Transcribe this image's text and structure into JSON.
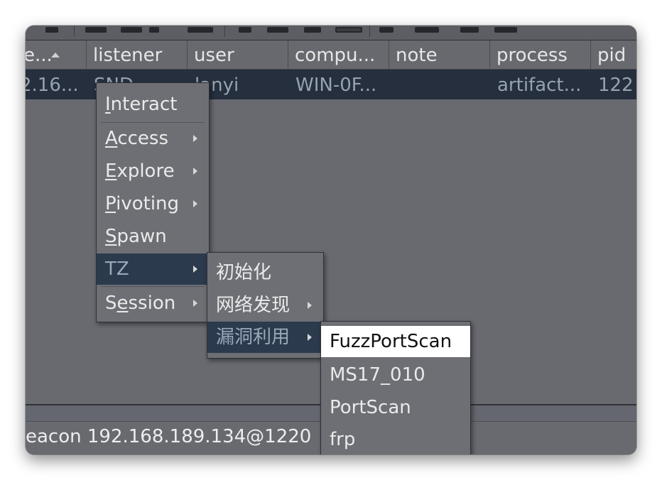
{
  "table": {
    "columns": [
      "e...",
      "listener",
      "user",
      "compu...",
      "note",
      "process",
      "pid"
    ],
    "row": {
      "external": "2.16...",
      "listener": "SND",
      "user": "lanyi",
      "computer": "WIN-0F...",
      "note": "",
      "process": "artifact...",
      "pid": "122"
    }
  },
  "status_bar": {
    "text": "eacon 192.168.189.134@1220"
  },
  "context_menu": {
    "items": [
      {
        "label_pre": "",
        "mnemonic": "I",
        "label_post": "nteract",
        "submenu": false
      },
      {
        "label_pre": "",
        "mnemonic": "A",
        "label_post": "ccess",
        "submenu": true
      },
      {
        "label_pre": "",
        "mnemonic": "E",
        "label_post": "xplore",
        "submenu": true
      },
      {
        "label_pre": "",
        "mnemonic": "P",
        "label_post": "ivoting",
        "submenu": true
      },
      {
        "label_pre": "",
        "mnemonic": "S",
        "label_post": "pawn",
        "submenu": false
      },
      {
        "label_pre": "TZ",
        "mnemonic": "",
        "label_post": "",
        "submenu": true,
        "selected": true
      },
      {
        "label_pre": "S",
        "mnemonic": "e",
        "label_post": "ssion",
        "submenu": true
      }
    ]
  },
  "tz_submenu": {
    "items": [
      {
        "label": "初始化",
        "submenu": false
      },
      {
        "label": "网络发现",
        "submenu": true
      },
      {
        "label": "漏洞利用",
        "submenu": true,
        "selected": true
      }
    ]
  },
  "exploit_submenu": {
    "items": [
      {
        "label": "FuzzPortScan",
        "highlighted": true
      },
      {
        "label": "MS17_010"
      },
      {
        "label": "PortScan"
      },
      {
        "label": "frp"
      }
    ]
  },
  "colors": {
    "selected_row_bg": "#252f3e",
    "menu_bg": "#6d6f74",
    "menu_selected_bg": "#2c3a4e",
    "menu_hover_bg": "#ffffff"
  }
}
